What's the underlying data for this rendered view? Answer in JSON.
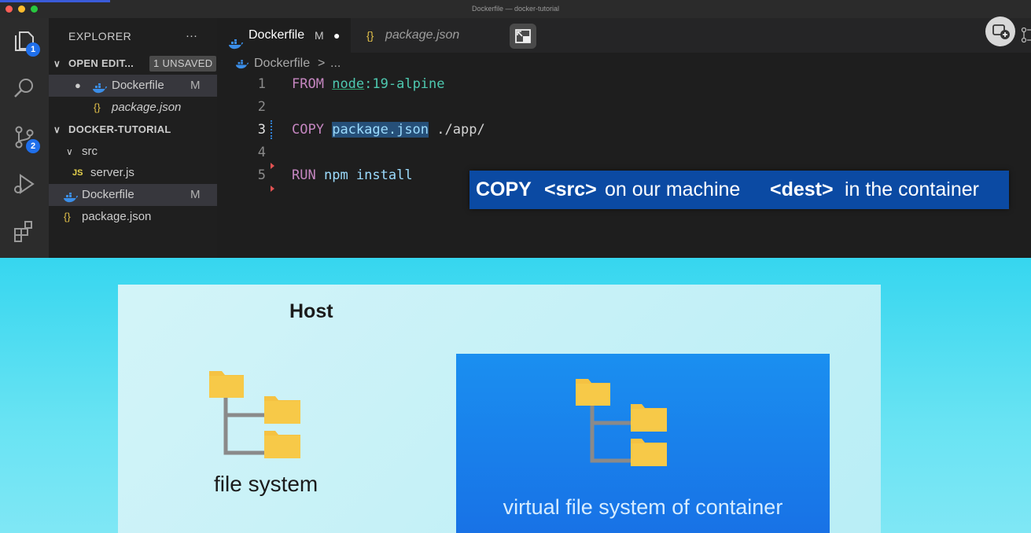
{
  "window": {
    "title": "Dockerfile — docker-tutorial"
  },
  "activity_bar": {
    "explorer_badge": "1",
    "scm_badge": "2",
    "icons": [
      "files-icon",
      "search-icon",
      "source-control-icon",
      "run-debug-icon",
      "extensions-icon"
    ]
  },
  "sidebar": {
    "title": "EXPLORER",
    "more": "···",
    "open_editors": {
      "label": "OPEN EDIT...",
      "badge": "1 UNSAVED",
      "items": [
        {
          "name": "Dockerfile",
          "status": "M",
          "dirty": "●",
          "icon": "docker-icon"
        },
        {
          "name": "package.json",
          "icon": "json-icon",
          "icon_text": "{}"
        }
      ]
    },
    "project": {
      "label": "DOCKER-TUTORIAL",
      "folder": "src",
      "items": [
        {
          "name": "server.js",
          "icon": "js-icon",
          "icon_text": "JS"
        },
        {
          "name": "Dockerfile",
          "status": "M",
          "icon": "docker-icon"
        },
        {
          "name": "package.json",
          "icon": "json-icon",
          "icon_text": "{}"
        }
      ]
    }
  },
  "tabs": [
    {
      "label": "Dockerfile",
      "status": "M",
      "dirty": "●",
      "active": true
    },
    {
      "label": "package.json",
      "icon_text": "{}",
      "active": false
    }
  ],
  "breadcrumb": {
    "file": "Dockerfile",
    "sep": ">",
    "rest": "..."
  },
  "editor": {
    "lines": [
      {
        "num": "1",
        "kw": "FROM",
        "a": "node",
        "b": ":19-alpine"
      },
      {
        "num": "2"
      },
      {
        "num": "3",
        "kw": "COPY",
        "sel": "package.json",
        "rest": "./app/"
      },
      {
        "num": "4"
      },
      {
        "num": "5",
        "kw": "RUN",
        "rest": "npm install"
      }
    ]
  },
  "caption": {
    "p1": "COPY",
    "p2": "<src>",
    "p3": "on our machine",
    "p4": "<dest>",
    "p5": "in the container"
  },
  "slide": {
    "host_label": "Host",
    "host_fs_label": "file system",
    "container_fs_label": "virtual file system of container"
  },
  "colors": {
    "accent": "#1f6feb",
    "caption_bg": "#0b4aa3",
    "slide_bg": "#36d6ef",
    "container_bg": "#1a8ff0",
    "folder": "#f5c242"
  }
}
